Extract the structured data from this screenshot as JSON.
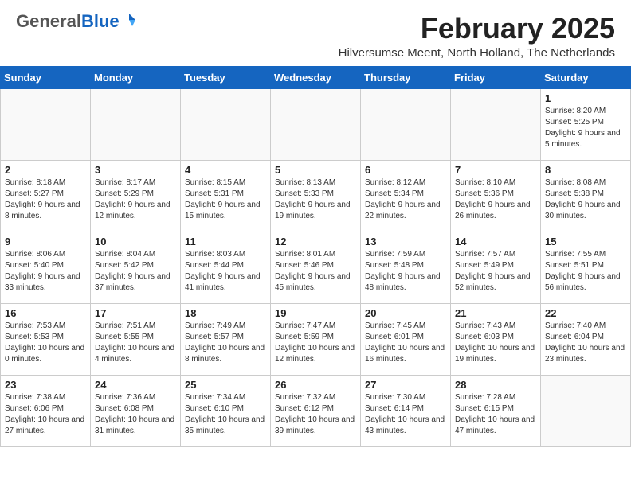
{
  "header": {
    "logo_general": "General",
    "logo_blue": "Blue",
    "month_title": "February 2025",
    "subtitle": "Hilversumse Meent, North Holland, The Netherlands"
  },
  "weekdays": [
    "Sunday",
    "Monday",
    "Tuesday",
    "Wednesday",
    "Thursday",
    "Friday",
    "Saturday"
  ],
  "weeks": [
    [
      {
        "day": "",
        "info": ""
      },
      {
        "day": "",
        "info": ""
      },
      {
        "day": "",
        "info": ""
      },
      {
        "day": "",
        "info": ""
      },
      {
        "day": "",
        "info": ""
      },
      {
        "day": "",
        "info": ""
      },
      {
        "day": "1",
        "info": "Sunrise: 8:20 AM\nSunset: 5:25 PM\nDaylight: 9 hours and 5 minutes."
      }
    ],
    [
      {
        "day": "2",
        "info": "Sunrise: 8:18 AM\nSunset: 5:27 PM\nDaylight: 9 hours and 8 minutes."
      },
      {
        "day": "3",
        "info": "Sunrise: 8:17 AM\nSunset: 5:29 PM\nDaylight: 9 hours and 12 minutes."
      },
      {
        "day": "4",
        "info": "Sunrise: 8:15 AM\nSunset: 5:31 PM\nDaylight: 9 hours and 15 minutes."
      },
      {
        "day": "5",
        "info": "Sunrise: 8:13 AM\nSunset: 5:33 PM\nDaylight: 9 hours and 19 minutes."
      },
      {
        "day": "6",
        "info": "Sunrise: 8:12 AM\nSunset: 5:34 PM\nDaylight: 9 hours and 22 minutes."
      },
      {
        "day": "7",
        "info": "Sunrise: 8:10 AM\nSunset: 5:36 PM\nDaylight: 9 hours and 26 minutes."
      },
      {
        "day": "8",
        "info": "Sunrise: 8:08 AM\nSunset: 5:38 PM\nDaylight: 9 hours and 30 minutes."
      }
    ],
    [
      {
        "day": "9",
        "info": "Sunrise: 8:06 AM\nSunset: 5:40 PM\nDaylight: 9 hours and 33 minutes."
      },
      {
        "day": "10",
        "info": "Sunrise: 8:04 AM\nSunset: 5:42 PM\nDaylight: 9 hours and 37 minutes."
      },
      {
        "day": "11",
        "info": "Sunrise: 8:03 AM\nSunset: 5:44 PM\nDaylight: 9 hours and 41 minutes."
      },
      {
        "day": "12",
        "info": "Sunrise: 8:01 AM\nSunset: 5:46 PM\nDaylight: 9 hours and 45 minutes."
      },
      {
        "day": "13",
        "info": "Sunrise: 7:59 AM\nSunset: 5:48 PM\nDaylight: 9 hours and 48 minutes."
      },
      {
        "day": "14",
        "info": "Sunrise: 7:57 AM\nSunset: 5:49 PM\nDaylight: 9 hours and 52 minutes."
      },
      {
        "day": "15",
        "info": "Sunrise: 7:55 AM\nSunset: 5:51 PM\nDaylight: 9 hours and 56 minutes."
      }
    ],
    [
      {
        "day": "16",
        "info": "Sunrise: 7:53 AM\nSunset: 5:53 PM\nDaylight: 10 hours and 0 minutes."
      },
      {
        "day": "17",
        "info": "Sunrise: 7:51 AM\nSunset: 5:55 PM\nDaylight: 10 hours and 4 minutes."
      },
      {
        "day": "18",
        "info": "Sunrise: 7:49 AM\nSunset: 5:57 PM\nDaylight: 10 hours and 8 minutes."
      },
      {
        "day": "19",
        "info": "Sunrise: 7:47 AM\nSunset: 5:59 PM\nDaylight: 10 hours and 12 minutes."
      },
      {
        "day": "20",
        "info": "Sunrise: 7:45 AM\nSunset: 6:01 PM\nDaylight: 10 hours and 16 minutes."
      },
      {
        "day": "21",
        "info": "Sunrise: 7:43 AM\nSunset: 6:03 PM\nDaylight: 10 hours and 19 minutes."
      },
      {
        "day": "22",
        "info": "Sunrise: 7:40 AM\nSunset: 6:04 PM\nDaylight: 10 hours and 23 minutes."
      }
    ],
    [
      {
        "day": "23",
        "info": "Sunrise: 7:38 AM\nSunset: 6:06 PM\nDaylight: 10 hours and 27 minutes."
      },
      {
        "day": "24",
        "info": "Sunrise: 7:36 AM\nSunset: 6:08 PM\nDaylight: 10 hours and 31 minutes."
      },
      {
        "day": "25",
        "info": "Sunrise: 7:34 AM\nSunset: 6:10 PM\nDaylight: 10 hours and 35 minutes."
      },
      {
        "day": "26",
        "info": "Sunrise: 7:32 AM\nSunset: 6:12 PM\nDaylight: 10 hours and 39 minutes."
      },
      {
        "day": "27",
        "info": "Sunrise: 7:30 AM\nSunset: 6:14 PM\nDaylight: 10 hours and 43 minutes."
      },
      {
        "day": "28",
        "info": "Sunrise: 7:28 AM\nSunset: 6:15 PM\nDaylight: 10 hours and 47 minutes."
      },
      {
        "day": "",
        "info": ""
      }
    ]
  ]
}
